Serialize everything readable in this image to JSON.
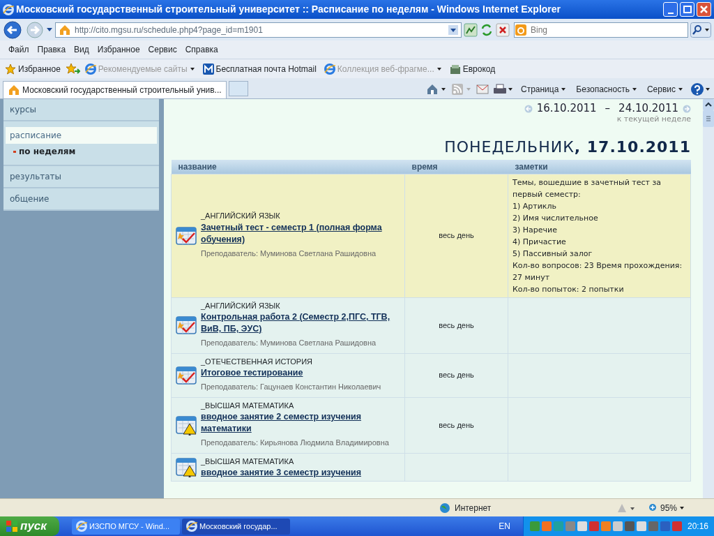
{
  "window": {
    "title": "Московский государственный строительный университет :: Расписание по неделям - Windows Internet Explorer"
  },
  "address_bar": {
    "url": "http://cito.mgsu.ru/schedule.php4?page_id=m1901",
    "search_placeholder": "Bing"
  },
  "menu": [
    "Файл",
    "Правка",
    "Вид",
    "Избранное",
    "Сервис",
    "Справка"
  ],
  "favorites_bar": {
    "label": "Избранное",
    "items": [
      {
        "label": "Рекомендуемые сайты",
        "kind": "ie",
        "disabled": true,
        "dropdown": true
      },
      {
        "label": "Бесплатная почта Hotmail",
        "kind": "mail",
        "disabled": false,
        "dropdown": false
      },
      {
        "label": "Коллекция веб-фрагме...",
        "kind": "ie",
        "disabled": true,
        "dropdown": true
      },
      {
        "label": "Еврокод",
        "kind": "app",
        "disabled": false,
        "dropdown": false
      }
    ]
  },
  "tabs": [
    {
      "label": "Московский государственный строительный унив...",
      "selected": true
    }
  ],
  "command_bar": [
    "Страница",
    "Безопасность",
    "Сервис"
  ],
  "sidebar": {
    "items": [
      {
        "label": "курсы",
        "selected": false
      },
      {
        "label": "расписание",
        "selected": true,
        "children": [
          {
            "label": "по неделям",
            "selected": true
          }
        ]
      },
      {
        "label": "результаты",
        "selected": false
      },
      {
        "label": "общение",
        "selected": false
      }
    ]
  },
  "week_nav": {
    "start": "16.10.2011",
    "dash": "–",
    "end": "24.10.2011",
    "current_link": "к текущей неделе"
  },
  "day_heading": "ПОНЕДЕЛЬНИК**, 17.10.2011**",
  "table": {
    "columns": [
      "название",
      "время",
      "заметки"
    ],
    "rows": [
      {
        "kind": "test",
        "highlighted": true,
        "subject": "_АНГЛИЙСКИЙ ЯЗЫК",
        "title": "Зачетный тест - семестр 1 (полная форма обучения)",
        "teacher_label": "Преподаватель:",
        "teacher": "Муминова Светлана Рашидовна",
        "time": "весь день",
        "notes": [
          "Темы, вошедшие в зачетный тест за первый семестр:",
          "1) Артикль",
          "2) Имя числительное",
          "3) Наречие",
          "4) Причастие",
          "5) Пассивный залог",
          "Кол-во вопросов: 23 Время прохождения: 27 минут",
          "Кол-во попыток: 2 попытки"
        ]
      },
      {
        "kind": "test",
        "highlighted": false,
        "subject": "_АНГЛИЙСКИЙ ЯЗЫК",
        "title": "Контрольная работа 2 (Семестр 2,ПГС, ТГВ, ВиВ, ПБ, ЭУС)",
        "teacher_label": "Преподаватель:",
        "teacher": "Муминова Светлана Рашидовна",
        "time": "весь день"
      },
      {
        "kind": "test",
        "highlighted": false,
        "subject": "_ОТЕЧЕСТВЕННАЯ ИСТОРИЯ",
        "title": "Итоговое тестирование",
        "teacher_label": "Преподаватель:",
        "teacher": "Гацунаев Константин Николаевич",
        "time": "весь день"
      },
      {
        "kind": "alert",
        "highlighted": false,
        "subject": "_ВЫСШАЯ МАТЕМАТИКА",
        "title": "вводное занятие 2 семестр изучения математики",
        "teacher_label": "Преподаватель:",
        "teacher": "Кирьянова Людмила Владимировна",
        "time": "весь день"
      },
      {
        "kind": "alert",
        "highlighted": false,
        "subject": "_ВЫСШАЯ МАТЕМАТИКА",
        "title": "вводное занятие 3 семестр изучения"
      }
    ]
  },
  "status_bar": {
    "zone": "Интернет",
    "zoom": "95%"
  },
  "taskbar": {
    "start": "пуск",
    "windows": [
      {
        "label": "ИЗСПО МГСУ - Wind...",
        "selected": false
      },
      {
        "label": "Московский государ...",
        "selected": true
      }
    ],
    "language": "EN",
    "clock": "20:16"
  }
}
